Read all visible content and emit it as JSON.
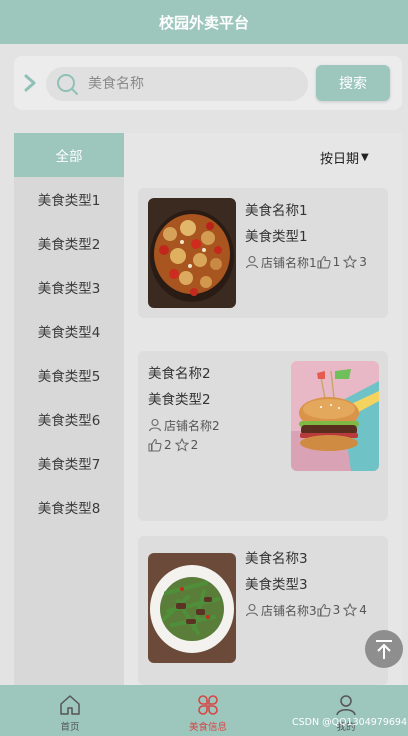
{
  "header": {
    "title": "校园外卖平台"
  },
  "search": {
    "placeholder": "美食名称",
    "button_label": "搜索"
  },
  "sidebar": {
    "items": [
      {
        "label": "全部",
        "active": true
      },
      {
        "label": "美食类型1"
      },
      {
        "label": "美食类型2"
      },
      {
        "label": "美食类型3"
      },
      {
        "label": "美食类型4"
      },
      {
        "label": "美食类型5"
      },
      {
        "label": "美食类型6"
      },
      {
        "label": "美食类型7"
      },
      {
        "label": "美食类型8"
      }
    ]
  },
  "sort": {
    "label": "按日期"
  },
  "foods": [
    {
      "name": "美食名称1",
      "type": "美食类型1",
      "shop": "店铺名称1",
      "likes": "1",
      "favorites": "3",
      "image": "kung-pao-chicken"
    },
    {
      "name": "美食名称2",
      "type": "美食类型2",
      "shop": "店铺名称2",
      "likes": "2",
      "favorites": "2",
      "image": "burger"
    },
    {
      "name": "美食名称3",
      "type": "美食类型3",
      "shop": "店铺名称3",
      "likes": "3",
      "favorites": "4",
      "image": "green-beans-stir-fry"
    }
  ],
  "tabbar": {
    "items": [
      {
        "label": "首页",
        "icon": "home-icon"
      },
      {
        "label": "美食信息",
        "icon": "grid-flower-icon",
        "active": true
      },
      {
        "label": "我的",
        "icon": "user-icon"
      }
    ]
  },
  "watermark": "CSDN @QQ1304979694",
  "colors": {
    "accent": "#9dc6bd",
    "active_tab": "#d64545",
    "background": "#e3e3e3"
  }
}
